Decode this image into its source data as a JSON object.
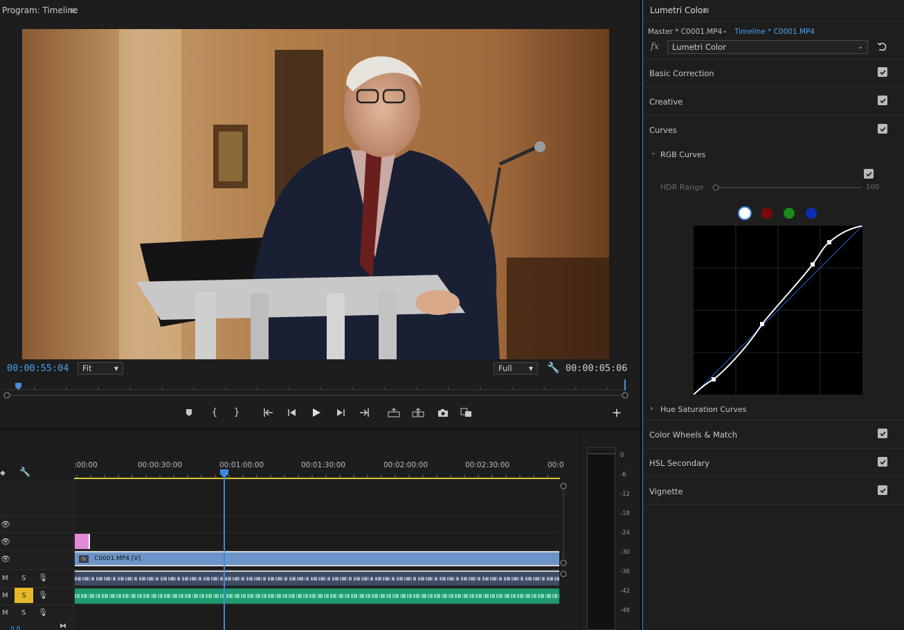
{
  "program": {
    "title": "Program: Timeline",
    "timecode_current": "00:00:55:04",
    "timecode_duration": "00:00:05:06",
    "zoom": "Fit",
    "resolution": "Full"
  },
  "lumetri": {
    "title": "Lumetri Color",
    "tab_master": "Master * C0001.MP4",
    "tab_timeline": "Timeline * C0001.MP4",
    "fx_label": "fx",
    "effect": "Lumetri Color",
    "sections": {
      "basic": "Basic Correction",
      "creative": "Creative",
      "curves": "Curves",
      "wheels": "Color Wheels & Match",
      "hsl": "HSL Secondary",
      "vignette": "Vignette"
    },
    "rgb_curves": "RGB Curves",
    "hdr_range_label": "HDR Range",
    "hdr_range_value": "100",
    "hue_sat": "Hue Saturation Curves",
    "accent": "#4aa3f0"
  },
  "timeline": {
    "ruler": [
      ":00:00",
      "00:00:30:00",
      "00:01:00:00",
      "00:01:30:00",
      "00:02:00:00",
      "00:02:30:00",
      "00:0"
    ],
    "clip_label": "C0001.MP4 [V]",
    "clip_fx": "fx",
    "track_m": "M",
    "track_s": "S",
    "bottom_partial": "0.0"
  },
  "meter": {
    "db": [
      "0",
      "-6",
      "-12",
      "-18",
      "-24",
      "-30",
      "-36",
      "-42",
      "-48"
    ]
  }
}
